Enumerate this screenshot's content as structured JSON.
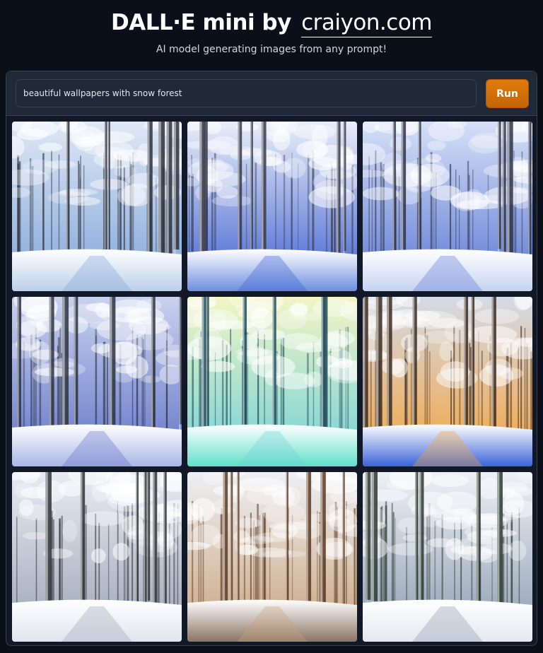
{
  "header": {
    "title_prefix": "DALL·E mini by",
    "title_link": "craiyon.com",
    "subtitle": "AI model generating images from any prompt!"
  },
  "prompt": {
    "value": "beautiful wallpapers with snow forest",
    "run_label": "Run"
  },
  "colors": {
    "background": "#0b0f19",
    "panel": "#111827",
    "accent": "#d97706"
  },
  "images": [
    {
      "name": "snow-forest-image-1",
      "sky": "#dfe8f5",
      "ground": "#bcd0ea",
      "trunk": "#2b2f3a",
      "accent": "#7fa4d8"
    },
    {
      "name": "snow-forest-image-2",
      "sky": "#e9eef8",
      "ground": "#6d8fe0",
      "trunk": "#3a3a4a",
      "accent": "#3d5fcf"
    },
    {
      "name": "snow-forest-image-3",
      "sky": "#d6e0f7",
      "ground": "#c6d3f1",
      "trunk": "#2d3346",
      "accent": "#5b78d3"
    },
    {
      "name": "snow-forest-image-4",
      "sky": "#c9d2ee",
      "ground": "#aab6e6",
      "trunk": "#2b3340",
      "accent": "#6073c7"
    },
    {
      "name": "snow-forest-image-5",
      "sky": "#f3f5c4",
      "ground": "#5fe0c9",
      "trunk": "#1f4a58",
      "accent": "#6fd0d8"
    },
    {
      "name": "snow-forest-image-6",
      "sky": "#d4dbe8",
      "ground": "#3a64d8",
      "trunk": "#3b2a20",
      "accent": "#f4a23a"
    },
    {
      "name": "snow-forest-image-7",
      "sky": "#e8ebf2",
      "ground": "#dfe5ef",
      "trunk": "#2f3236",
      "accent": "#9aa3b4"
    },
    {
      "name": "snow-forest-image-8",
      "sky": "#eef0f4",
      "ground": "#8a7464",
      "trunk": "#5a3a22",
      "accent": "#c9a27a"
    },
    {
      "name": "snow-forest-image-9",
      "sky": "#eef1f6",
      "ground": "#e4e8ef",
      "trunk": "#2c3a30",
      "accent": "#8a9bb0"
    }
  ]
}
